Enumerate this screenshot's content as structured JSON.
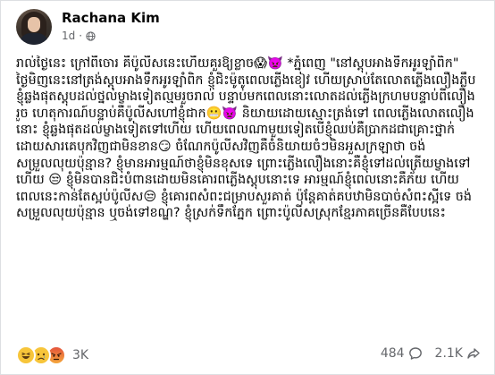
{
  "post": {
    "author": "Rachana Kim",
    "time": "1d",
    "separator": "·",
    "body": "រាល់ថ្ងៃនេះ ក្រៅពីចោរ គឺប៉ូលីសនេះហើយគួរឱ្យខ្លាច😱👿 *ភ្នំពេញ \"នៅស្តុបអាងទឹកអូរឡាំពិក\"\nថ្ងៃមិញនេះនៅត្រង់ស្តុបអាងទឹកអូរឡាំពិក ខ្ញុំជិះម៉ូតូពេលភ្លើងខៀវ ហើយស្រាប់តែលោតភ្លើងលឿងភ្លឹប ខ្ញុំឆ្លងផុតស្តុបដល់ថ្នល់ម្ខាងទៀតល្មមរួចរាល់ បន្ទាប់មកពេលនោះលោតដល់ភ្លើងក្រហមបន្ទាប់ពីលឿងរួច ហេតុការណ៍បន្ទាប់គឺប៉ូលីសហៅខ្ញុំជាក😬👿 និយាយដោយស្មោះត្រង់ទៅ ពេលភ្លើងលោតលឿងនោះ ខ្ញុំឆ្លងផុតដល់ម្ខាងទៀតទៅហើយ ហើយពេលណាមួយទៀតបើខ្ញុំឈប់គឺប្រាកដជាគ្រោះថ្នាក់ដោយសារគេបុកវិញជាមិនខាន😏 ចំណែកប៉ូលីសវិញគឺចំនិយាយចំៗមិនអួសក្រឡាថា ចង់សម្រួលលុយប៉ុន្មាន? ខ្ញុំមានអារម្មណ៍ថាខ្ញុំមិនខុសទេ ព្រោះភ្លើងលឿងនោះគឺខ្ញុំទៅដល់ត្រើយម្ខាងទៅហើយ 😒 ខ្ញុំមិនបានជិះបំពានដោយមិនគោរពភ្លើងស្តុបនោះទេ អារម្មណ៍ខ្ញុំពេលនោះគឺភ័យ ហើយពេលនេះកាន់តែស្អប់ប៉ូលីស😒 ខ្ញុំគោរពសំពះជម្រាបសួរគាត់ ប៉ុន្តែគាត់គបឋាមិនបាច់សំពះស្អីទេ ចង់សម្រួលលុយប៉ុន្មាន ឬចង់ទៅខណ្ឌ? ខ្ញុំស្រក់ទឹកភ្នែក ព្រោះប៉ូលីសស្រុកខ្មែរភាគច្រើនគឺបែបនេះ"
  },
  "reactions": {
    "types": [
      "haha-icon",
      "sad-icon",
      "angry-icon"
    ],
    "count": "3K"
  },
  "stats": {
    "comments": "484",
    "shares": "2.1K"
  },
  "colors": {
    "text": "#050505",
    "secondary": "#65676b",
    "reaction_yellow": "#f7c53a",
    "reaction_angry": "#e5533b"
  }
}
